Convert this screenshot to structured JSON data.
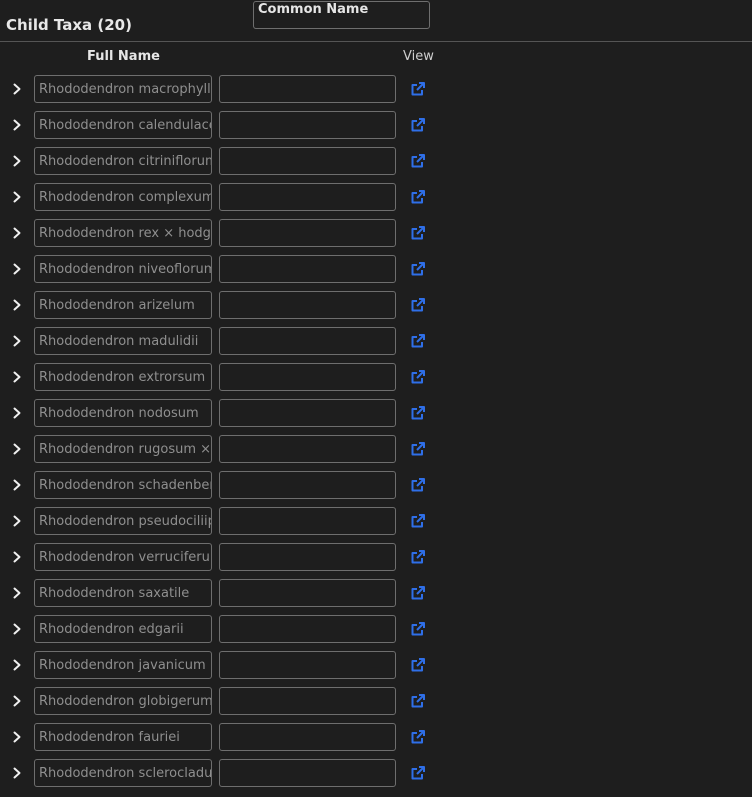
{
  "panel": {
    "title": "Child Taxa (20)"
  },
  "columns": {
    "full_name": "Full Name",
    "common_name": "Common Name",
    "view": "View"
  },
  "colors": {
    "background": "#1e1e1e",
    "link_icon": "#2f6fe8",
    "border": "#6e6e6e"
  },
  "icons": {
    "expander": "chevron-right-icon",
    "view": "external-link-icon"
  },
  "rows": [
    {
      "full_name": "Rhododendron macrophyllum",
      "common_name": ""
    },
    {
      "full_name": "Rhododendron calendulaceum",
      "common_name": ""
    },
    {
      "full_name": "Rhododendron citriniflorum",
      "common_name": ""
    },
    {
      "full_name": "Rhododendron complexum",
      "common_name": ""
    },
    {
      "full_name": "Rhododendron rex × hodgsonii",
      "common_name": ""
    },
    {
      "full_name": "Rhododendron niveoflorum",
      "common_name": ""
    },
    {
      "full_name": "Rhododendron arizelum",
      "common_name": ""
    },
    {
      "full_name": "Rhododendron madulidii",
      "common_name": ""
    },
    {
      "full_name": "Rhododendron extrorsum",
      "common_name": ""
    },
    {
      "full_name": "Rhododendron nodosum",
      "common_name": ""
    },
    {
      "full_name": "Rhododendron rugosum × ",
      "common_name": ""
    },
    {
      "full_name": "Rhododendron schadenbergii",
      "common_name": ""
    },
    {
      "full_name": "Rhododendron pseudociliipes",
      "common_name": ""
    },
    {
      "full_name": "Rhododendron verruciferum",
      "common_name": ""
    },
    {
      "full_name": "Rhododendron saxatile",
      "common_name": ""
    },
    {
      "full_name": "Rhododendron edgarii",
      "common_name": ""
    },
    {
      "full_name": "Rhododendron javanicum",
      "common_name": ""
    },
    {
      "full_name": "Rhododendron globigerum",
      "common_name": ""
    },
    {
      "full_name": "Rhododendron fauriei",
      "common_name": ""
    },
    {
      "full_name": "Rhododendron sclerocladum",
      "common_name": ""
    }
  ]
}
